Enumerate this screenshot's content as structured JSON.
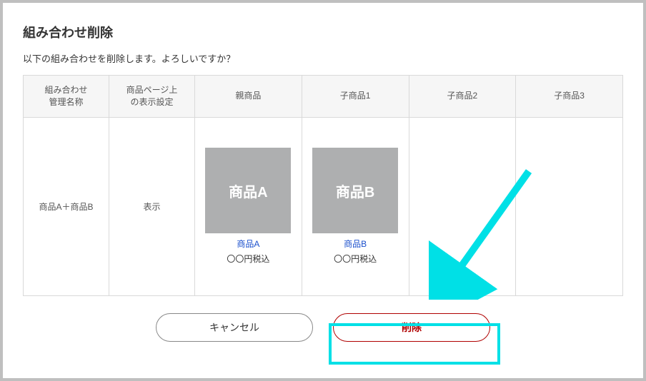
{
  "dialog": {
    "title": "組み合わせ削除",
    "subtitle": "以下の組み合わせを削除します。よろしいですか？"
  },
  "table": {
    "headers": {
      "name": "組み合わせ\n管理名称",
      "display": "商品ページ上\nの表示設定",
      "parent": "親商品",
      "child1": "子商品1",
      "child2": "子商品2",
      "child3": "子商品3"
    },
    "row": {
      "name": "商品A＋商品B",
      "display": "表示",
      "parent": {
        "img_label": "商品A",
        "link": "商品A",
        "price": "〇〇円税込"
      },
      "child1": {
        "img_label": "商品B",
        "link": "商品B",
        "price": "〇〇円税込"
      }
    }
  },
  "buttons": {
    "cancel": "キャンセル",
    "delete": "削除"
  },
  "annotation": {
    "highlight_color": "#00e0e6"
  }
}
